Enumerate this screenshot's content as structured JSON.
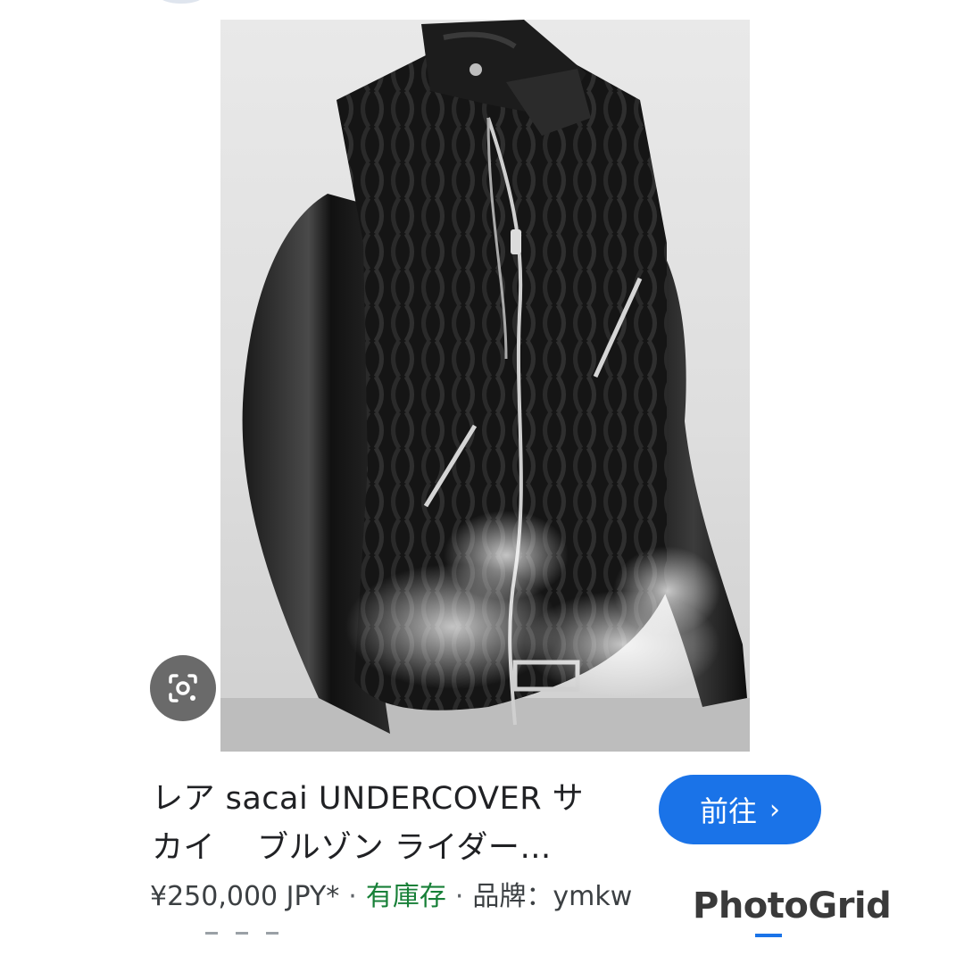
{
  "result": {
    "title_line1": "レア sacai UNDERCOVER サ",
    "title_line2": "カイ　 ブルゾン ライダー…",
    "go_button_label": "前往",
    "price": "¥250,000 JPY*",
    "separator": "·",
    "stock_status": "有庫存",
    "brand_label": "品牌：ymkw"
  },
  "icons": {
    "lens": "google-lens-icon",
    "chevron": "chevron-right-icon"
  },
  "watermark": "PhotoGrid",
  "colors": {
    "go_button": "#1a73e8",
    "stock": "#188038",
    "lens_button": "#6a6a6a"
  }
}
